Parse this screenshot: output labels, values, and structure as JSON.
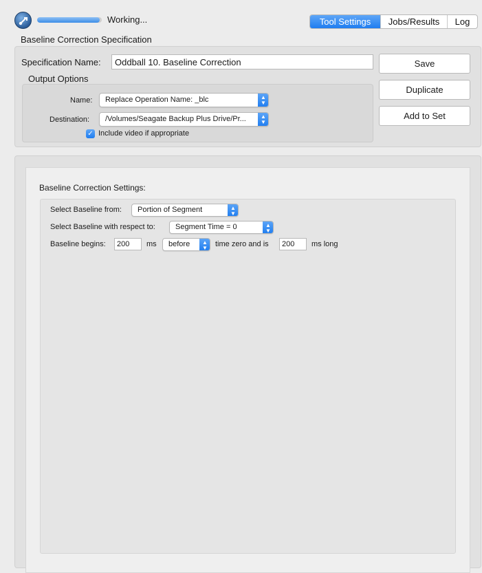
{
  "header": {
    "status": "Working...",
    "progress": 0.97,
    "tabs": [
      {
        "label": "Tool Settings",
        "active": true
      },
      {
        "label": "Jobs/Results",
        "active": false
      },
      {
        "label": "Log",
        "active": false
      }
    ]
  },
  "spec": {
    "section_title": "Baseline Correction Specification",
    "name_label": "Specification Name:",
    "name_value": "Oddball 10. Baseline Correction",
    "output_options_title": "Output Options",
    "name_field_label": "Name:",
    "name_popup_value": "Replace Operation Name: _blc",
    "destination_label": "Destination:",
    "destination_popup_value": "/Volumes/Seagate Backup Plus Drive/Pr...",
    "include_video_label": "Include video if appropriate",
    "include_video_checked": true
  },
  "buttons": {
    "save": "Save",
    "duplicate": "Duplicate",
    "add_to_set": "Add to Set"
  },
  "settings": {
    "title": "Baseline Correction Settings:",
    "select_from_label": "Select Baseline from:",
    "select_from_value": "Portion of Segment",
    "select_respect_label": "Select Baseline with respect to:",
    "select_respect_value": "Segment Time = 0",
    "begins_label": "Baseline begins:",
    "begins_value": "200",
    "ms_label": "ms",
    "relation_value": "before",
    "time_zero_label": "time zero and is",
    "length_value": "200",
    "ms_long_label": "ms long"
  },
  "colors": {
    "accent": "#1f7df0",
    "background": "#ececec"
  },
  "icons": {
    "app": "app-logo-icon",
    "popup_stepper": "chevron-up-down-icon",
    "checkbox": "checkmark-icon"
  }
}
